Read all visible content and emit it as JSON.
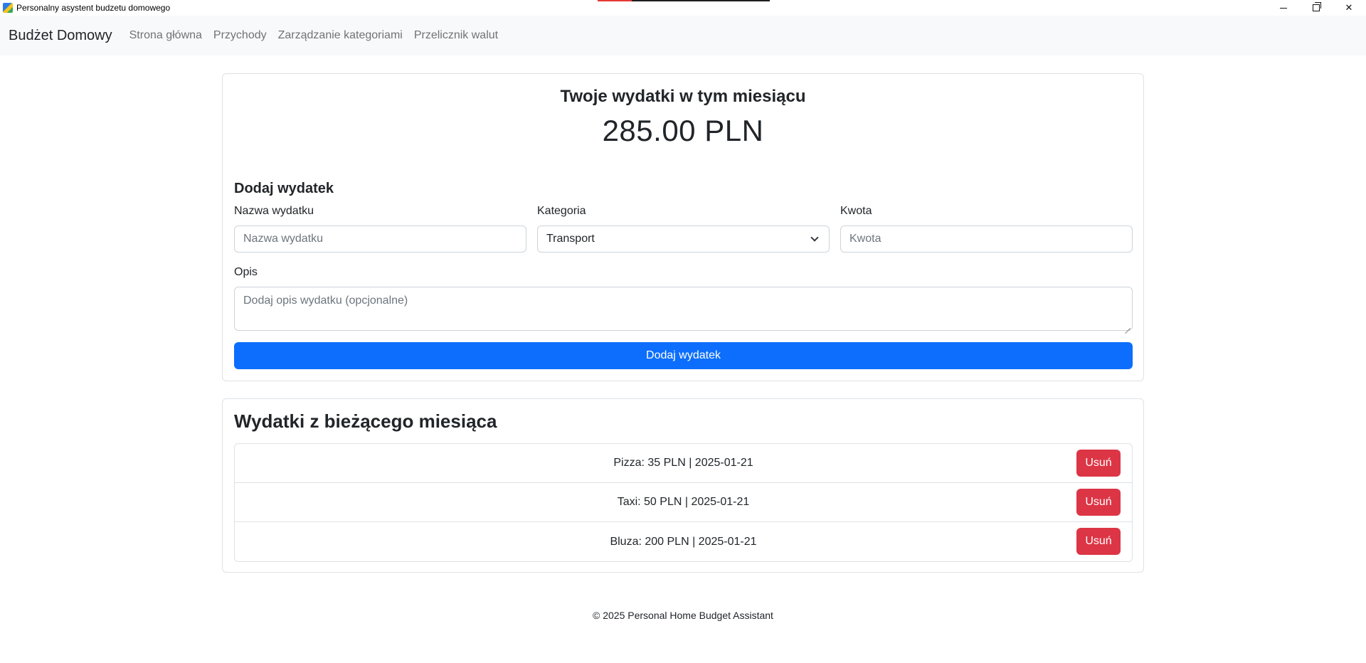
{
  "window": {
    "title": "Personalny asystent budzetu domowego",
    "controls": {
      "minimize": "minimize-icon",
      "restore": "restore-icon",
      "close": "close-icon"
    }
  },
  "navbar": {
    "brand": "Budżet Domowy",
    "links": [
      "Strona główna",
      "Przychody",
      "Zarządzanie kategoriami",
      "Przelicznik walut"
    ]
  },
  "summary": {
    "title": "Twoje wydatki w tym miesiącu",
    "amount": "285.00 PLN"
  },
  "form": {
    "title": "Dodaj wydatek",
    "name_label": "Nazwa wydatku",
    "name_placeholder": "Nazwa wydatku",
    "name_value": "",
    "category_label": "Kategoria",
    "category_selected": "Transport",
    "amount_label": "Kwota",
    "amount_placeholder": "Kwota",
    "amount_value": "",
    "description_label": "Opis",
    "description_placeholder": "Dodaj opis wydatku (opcjonalne)",
    "description_value": "",
    "submit_label": "Dodaj wydatek",
    "colors": {
      "primary": "#0d6efd",
      "danger": "#dc3545"
    }
  },
  "expenses": {
    "title": "Wydatki z bieżącego miesiąca",
    "items": [
      {
        "text": "Pizza: 35 PLN | 2025-01-21",
        "delete_label": "Usuń"
      },
      {
        "text": "Taxi: 50 PLN | 2025-01-21",
        "delete_label": "Usuń"
      },
      {
        "text": "Bluza: 200 PLN | 2025-01-21",
        "delete_label": "Usuń"
      }
    ]
  },
  "footer": {
    "text": "© 2025 Personal Home Budget Assistant"
  }
}
